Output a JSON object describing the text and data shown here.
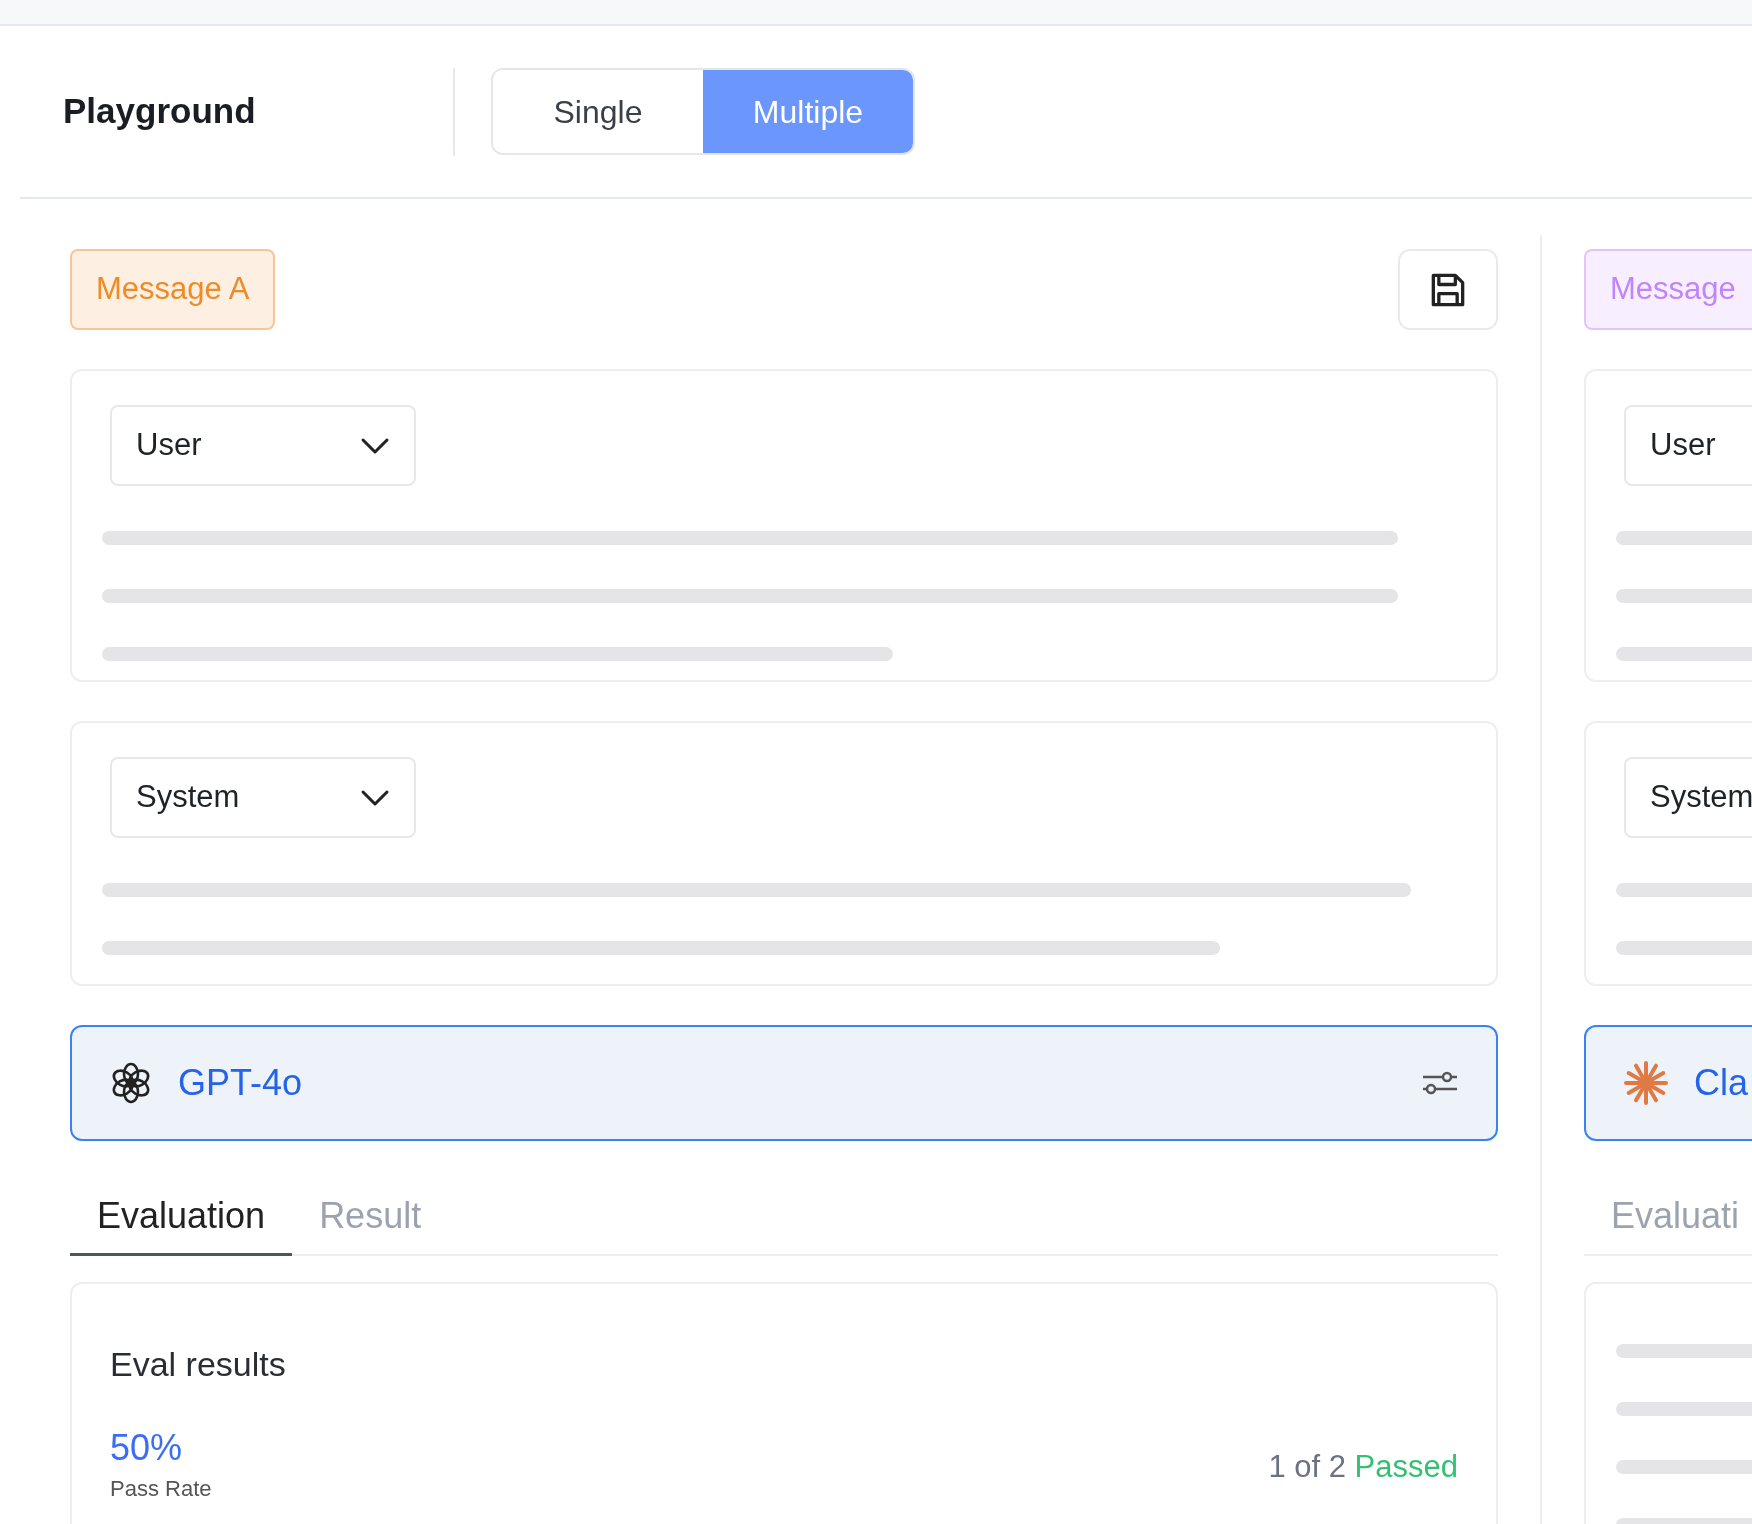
{
  "header": {
    "title": "Playground",
    "modes": [
      {
        "label": "Single",
        "selected": false
      },
      {
        "label": "Multiple",
        "selected": true
      }
    ]
  },
  "panels": [
    {
      "badge": {
        "label": "Message A",
        "color": "#f08a24"
      },
      "save": true,
      "messages": [
        {
          "role": "User"
        },
        {
          "role": "System"
        }
      ],
      "model": {
        "name": "GPT-4o",
        "kind": "knot"
      },
      "tabs": [
        {
          "label": "Evaluation",
          "selected": true
        },
        {
          "label": "Result",
          "selected": false
        }
      ],
      "eval": {
        "kind": "results",
        "title": "Eval results",
        "rate": "50%",
        "rate_label": "Pass Rate",
        "count": "1 of 2",
        "status": "Passed"
      }
    },
    {
      "badge": {
        "label": "Message",
        "color": "#c084fc"
      },
      "messages": [
        {
          "role": "User"
        },
        {
          "role": "System"
        }
      ],
      "model": {
        "name": "Cla",
        "kind": "starburst"
      },
      "tabs": [
        {
          "label": "Evaluati",
          "selected": false
        }
      ],
      "eval": {
        "kind": "loading"
      }
    }
  ]
}
